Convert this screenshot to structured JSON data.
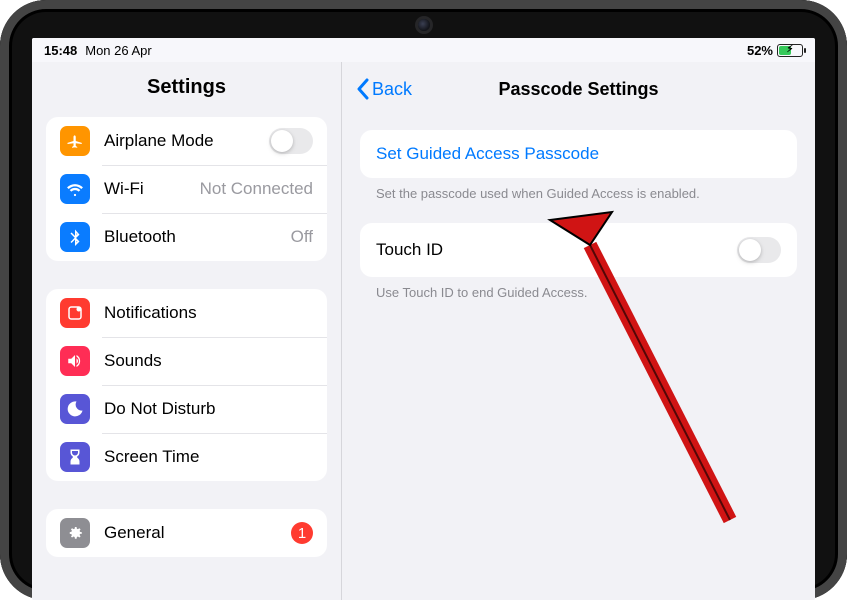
{
  "statusbar": {
    "time": "15:48",
    "date": "Mon 26 Apr",
    "battery_pct": "52%"
  },
  "sidebar": {
    "title": "Settings",
    "g1": {
      "airplane": "Airplane Mode",
      "wifi": "Wi-Fi",
      "wifi_value": "Not Connected",
      "bluetooth": "Bluetooth",
      "bluetooth_value": "Off"
    },
    "g2": {
      "notifications": "Notifications",
      "sounds": "Sounds",
      "dnd": "Do Not Disturb",
      "screentime": "Screen Time"
    },
    "g3": {
      "general": "General",
      "general_badge": "1"
    }
  },
  "detail": {
    "back": "Back",
    "title": "Passcode Settings",
    "set_passcode": "Set Guided Access Passcode",
    "set_passcode_footer": "Set the passcode used when Guided Access is enabled.",
    "touchid": "Touch ID",
    "touchid_footer": "Use Touch ID to end Guided Access.",
    "touchid_on": false
  },
  "colors": {
    "link": "#007aff",
    "orange": "#ff9500",
    "blue": "#0a7cff",
    "red": "#ff3b30",
    "pink": "#ff2d55",
    "purple": "#5856d6",
    "gray": "#8e8e93"
  }
}
